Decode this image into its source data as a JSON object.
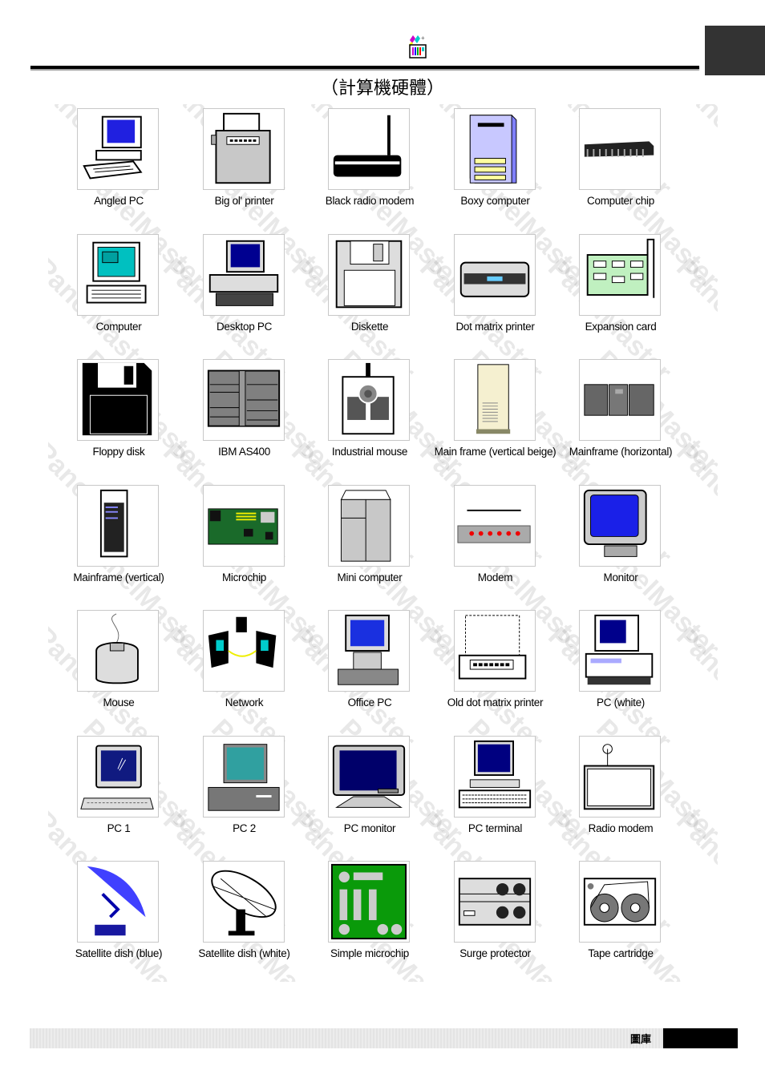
{
  "header": {
    "icon": "gallery-palette-icon",
    "subtitle": "（計算機硬體）"
  },
  "items": [
    {
      "label": "Angled PC",
      "icon": "angled-pc-icon"
    },
    {
      "label": "Big ol' printer",
      "icon": "big-printer-icon"
    },
    {
      "label": "Black radio modem",
      "icon": "black-radio-modem-icon"
    },
    {
      "label": "Boxy computer",
      "icon": "boxy-computer-icon"
    },
    {
      "label": "Computer chip",
      "icon": "computer-chip-icon"
    },
    {
      "label": "Computer",
      "icon": "computer-icon"
    },
    {
      "label": "Desktop PC",
      "icon": "desktop-pc-icon"
    },
    {
      "label": "Diskette",
      "icon": "diskette-icon"
    },
    {
      "label": "Dot matrix printer",
      "icon": "dot-matrix-printer-icon"
    },
    {
      "label": "Expansion card",
      "icon": "expansion-card-icon"
    },
    {
      "label": "Floppy disk",
      "icon": "floppy-disk-icon"
    },
    {
      "label": "IBM AS400",
      "icon": "ibm-as400-icon"
    },
    {
      "label": "Industrial mouse",
      "icon": "industrial-mouse-icon"
    },
    {
      "label": "Main frame (vertical beige)",
      "icon": "mainframe-vertical-beige-icon"
    },
    {
      "label": "Mainframe (horizontal)",
      "icon": "mainframe-horizontal-icon"
    },
    {
      "label": "Mainframe (vertical)",
      "icon": "mainframe-vertical-icon"
    },
    {
      "label": "Microchip",
      "icon": "microchip-icon"
    },
    {
      "label": "Mini computer",
      "icon": "mini-computer-icon"
    },
    {
      "label": "Modem",
      "icon": "modem-icon"
    },
    {
      "label": "Monitor",
      "icon": "monitor-icon"
    },
    {
      "label": "Mouse",
      "icon": "mouse-icon"
    },
    {
      "label": "Network",
      "icon": "network-icon"
    },
    {
      "label": "Office PC",
      "icon": "office-pc-icon"
    },
    {
      "label": "Old dot matrix printer",
      "icon": "old-dot-matrix-printer-icon"
    },
    {
      "label": "PC (white)",
      "icon": "pc-white-icon"
    },
    {
      "label": "PC 1",
      "icon": "pc-1-icon"
    },
    {
      "label": "PC 2",
      "icon": "pc-2-icon"
    },
    {
      "label": "PC monitor",
      "icon": "pc-monitor-icon"
    },
    {
      "label": "PC terminal",
      "icon": "pc-terminal-icon"
    },
    {
      "label": "Radio modem",
      "icon": "radio-modem-icon"
    },
    {
      "label": "Satellite dish (blue)",
      "icon": "satellite-dish-blue-icon"
    },
    {
      "label": "Satellite dish (white)",
      "icon": "satellite-dish-white-icon"
    },
    {
      "label": "Simple microchip",
      "icon": "simple-microchip-icon"
    },
    {
      "label": "Surge protector",
      "icon": "surge-protector-icon"
    },
    {
      "label": "Tape cartridge",
      "icon": "tape-cartridge-icon"
    }
  ],
  "watermark": "PanelMaster",
  "footer": {
    "text": "圖庫"
  }
}
